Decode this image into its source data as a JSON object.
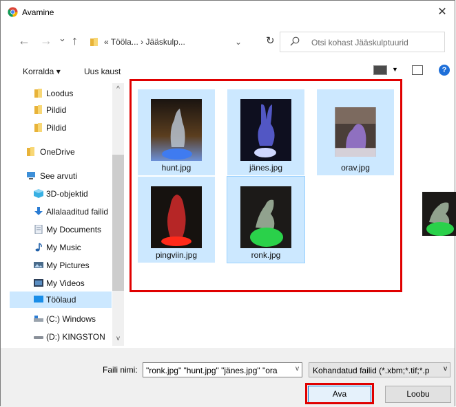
{
  "window": {
    "title": "Avamine",
    "close_glyph": "✕"
  },
  "address": {
    "back_glyph": "←",
    "forward_glyph": "→",
    "recent_glyph": "⌄",
    "up_glyph": "↑",
    "breadcrumb": "«  Tööla...  ›  Jääskulp...",
    "dropdown_glyph": "⌄",
    "refresh_glyph": "↻",
    "search_placeholder": "Otsi kohast Jääskulptuurid"
  },
  "toolbar": {
    "organize_label": "Korralda ▾",
    "new_folder_label": "Uus kaust",
    "help_glyph": "?"
  },
  "tree": [
    {
      "label": "Loodus",
      "icon": "folder-icon"
    },
    {
      "label": "Pildid",
      "icon": "folder-icon"
    },
    {
      "label": "Pildid",
      "icon": "folder-icon"
    },
    {
      "label": "OneDrive",
      "icon": "onedrive-folder-icon"
    },
    {
      "label": "See arvuti",
      "icon": "computer-icon"
    },
    {
      "label": "3D-objektid",
      "icon": "cube-icon"
    },
    {
      "label": "Allalaaditud failid",
      "icon": "download-icon"
    },
    {
      "label": "My Documents",
      "icon": "documents-icon"
    },
    {
      "label": "My Music",
      "icon": "music-icon"
    },
    {
      "label": "My Pictures",
      "icon": "pictures-icon"
    },
    {
      "label": "My Videos",
      "icon": "videos-icon"
    },
    {
      "label": "Töölaud",
      "icon": "desktop-icon"
    },
    {
      "label": "(C:) Windows",
      "icon": "drive-icon"
    },
    {
      "label": "(D:) KINGSTON",
      "icon": "usb-drive-icon"
    }
  ],
  "files": [
    {
      "name": "hunt.jpg"
    },
    {
      "name": "jänes.jpg"
    },
    {
      "name": "orav.jpg"
    },
    {
      "name": "pingviin.jpg"
    },
    {
      "name": "ronk.jpg"
    }
  ],
  "bottom": {
    "filename_label": "Faili nimi:",
    "filename_value": "\"ronk.jpg\" \"hunt.jpg\" \"jänes.jpg\" \"ora",
    "filetype_value": "Kohandatud failid (*.xbm;*.tif;*.p",
    "open_label": "Ava",
    "cancel_label": "Loobu"
  },
  "colors": {
    "selection": "#cce8ff",
    "highlight_red": "#e00000",
    "accent": "#0078d7"
  }
}
